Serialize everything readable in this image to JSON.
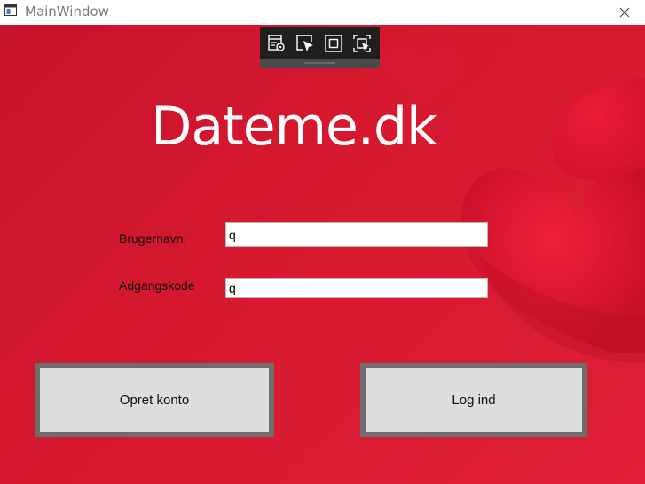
{
  "window": {
    "title": "MainWindow"
  },
  "icons": {
    "app": "window-app-icon",
    "close": "close-icon",
    "toolbar": [
      "live-visual-tree-icon",
      "select-element-icon",
      "display-layout-adorners-icon",
      "track-focus-icon"
    ]
  },
  "colors": {
    "background": "#d6192f",
    "heart": "#e8102e",
    "button_face": "#dddddd",
    "button_border": "#6d6d6d"
  },
  "heading": "Dateme.dk",
  "form": {
    "username_label": "Brugernavn:",
    "username_value": "q",
    "password_label": "Adgangskode",
    "password_value": "q"
  },
  "buttons": {
    "create_account": "Opret konto",
    "login": "Log ind"
  }
}
